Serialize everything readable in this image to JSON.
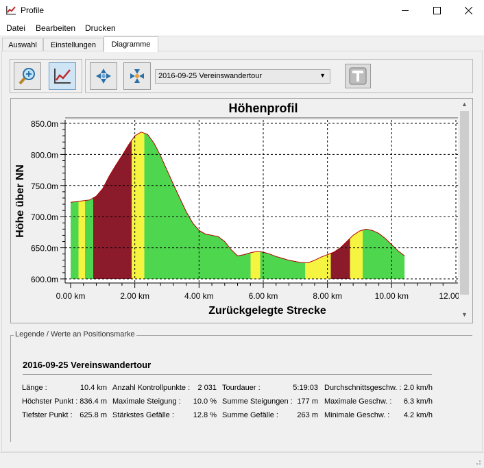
{
  "window": {
    "title": "Profile",
    "icon": "profile-chart-icon"
  },
  "menu": {
    "items": [
      "Datei",
      "Bearbeiten",
      "Drucken"
    ]
  },
  "tabs": [
    {
      "label": "Auswahl",
      "active": false
    },
    {
      "label": "Einstellungen",
      "active": false
    },
    {
      "label": "Diagramme",
      "active": true
    }
  ],
  "toolbar": {
    "buttons": [
      "zoom-icon",
      "profile-chart-icon",
      "expand-arrows-icon",
      "collapse-arrows-icon",
      "text-tool-icon"
    ],
    "route_select": "2016-09-25 Vereinswandertour"
  },
  "chart_data": {
    "type": "area",
    "title": "Höhenprofil",
    "xlabel": "Zurückgelegte Strecke",
    "ylabel": "Höhe über NN",
    "xlim": [
      0,
      12
    ],
    "ylim": [
      600,
      850
    ],
    "x_ticks": [
      "0.00 km",
      "2.00 km",
      "4.00 km",
      "6.00 km",
      "8.00 km",
      "10.00 km",
      "12.00 km"
    ],
    "y_ticks": [
      "600.0m",
      "650.0m",
      "700.0m",
      "750.0m",
      "800.0m",
      "850.0m"
    ],
    "grid": true,
    "fill_colors": {
      "flat": "#4fd64f",
      "moderate": "#f5f541",
      "steep": "#8b1a2a",
      "line": "#b00000"
    },
    "x": [
      0.0,
      0.3,
      0.6,
      0.8,
      1.0,
      1.2,
      1.4,
      1.6,
      1.8,
      2.0,
      2.2,
      2.4,
      2.6,
      2.8,
      3.0,
      3.2,
      3.4,
      3.6,
      3.8,
      4.0,
      4.2,
      4.4,
      4.6,
      4.8,
      5.0,
      5.2,
      5.4,
      5.6,
      5.8,
      6.0,
      6.2,
      6.4,
      6.6,
      6.8,
      7.0,
      7.2,
      7.4,
      7.6,
      7.8,
      8.0,
      8.2,
      8.4,
      8.6,
      8.8,
      9.0,
      9.2,
      9.4,
      9.6,
      9.8,
      10.0,
      10.2,
      10.4
    ],
    "y": [
      723,
      725,
      727,
      733,
      745,
      765,
      782,
      798,
      815,
      830,
      836,
      832,
      818,
      798,
      775,
      752,
      730,
      708,
      690,
      678,
      672,
      670,
      668,
      660,
      647,
      637,
      639,
      642,
      644,
      643,
      640,
      636,
      633,
      630,
      628,
      626,
      626,
      630,
      635,
      639,
      643,
      650,
      660,
      670,
      677,
      680,
      678,
      673,
      665,
      655,
      645,
      637
    ],
    "slope_bands": [
      {
        "from": 0.0,
        "to": 0.25,
        "level": "flat"
      },
      {
        "from": 0.25,
        "to": 0.45,
        "level": "moderate"
      },
      {
        "from": 0.45,
        "to": 0.7,
        "level": "flat"
      },
      {
        "from": 0.7,
        "to": 1.9,
        "level": "steep"
      },
      {
        "from": 1.9,
        "to": 2.3,
        "level": "moderate"
      },
      {
        "from": 2.3,
        "to": 5.6,
        "level": "flat"
      },
      {
        "from": 5.6,
        "to": 5.9,
        "level": "moderate"
      },
      {
        "from": 5.9,
        "to": 7.3,
        "level": "flat"
      },
      {
        "from": 7.3,
        "to": 8.1,
        "level": "moderate"
      },
      {
        "from": 8.1,
        "to": 8.7,
        "level": "steep"
      },
      {
        "from": 8.7,
        "to": 9.1,
        "level": "moderate"
      },
      {
        "from": 9.1,
        "to": 10.4,
        "level": "flat"
      }
    ]
  },
  "legend": {
    "caption": "Legende / Werte an Positionsmarke",
    "tour_name": "2016-09-25 Vereinswandertour",
    "stats": [
      [
        {
          "label": "Länge :",
          "value": "10.4 km"
        },
        {
          "label": "Höchster Punkt :",
          "value": "836.4 m"
        },
        {
          "label": "Tiefster Punkt :",
          "value": "625.8 m"
        }
      ],
      [
        {
          "label": "Anzahl Kontrollpunkte :",
          "value": "2 031"
        },
        {
          "label": "Maximale Steigung :",
          "value": "10.0 %"
        },
        {
          "label": "Stärkstes Gefälle :",
          "value": "12.8 %"
        }
      ],
      [
        {
          "label": "Tourdauer :",
          "value": "5:19:03"
        },
        {
          "label": "Summe Steigungen :",
          "value": "177 m"
        },
        {
          "label": "Summe Gefälle :",
          "value": "263 m"
        }
      ],
      [
        {
          "label": "Durchschnittsgeschw. :",
          "value": "2.0 km/h"
        },
        {
          "label": "Maximale Geschw. :",
          "value": "6.3 km/h"
        },
        {
          "label": "Minimale Geschw. :",
          "value": "4.2 km/h"
        }
      ]
    ]
  }
}
